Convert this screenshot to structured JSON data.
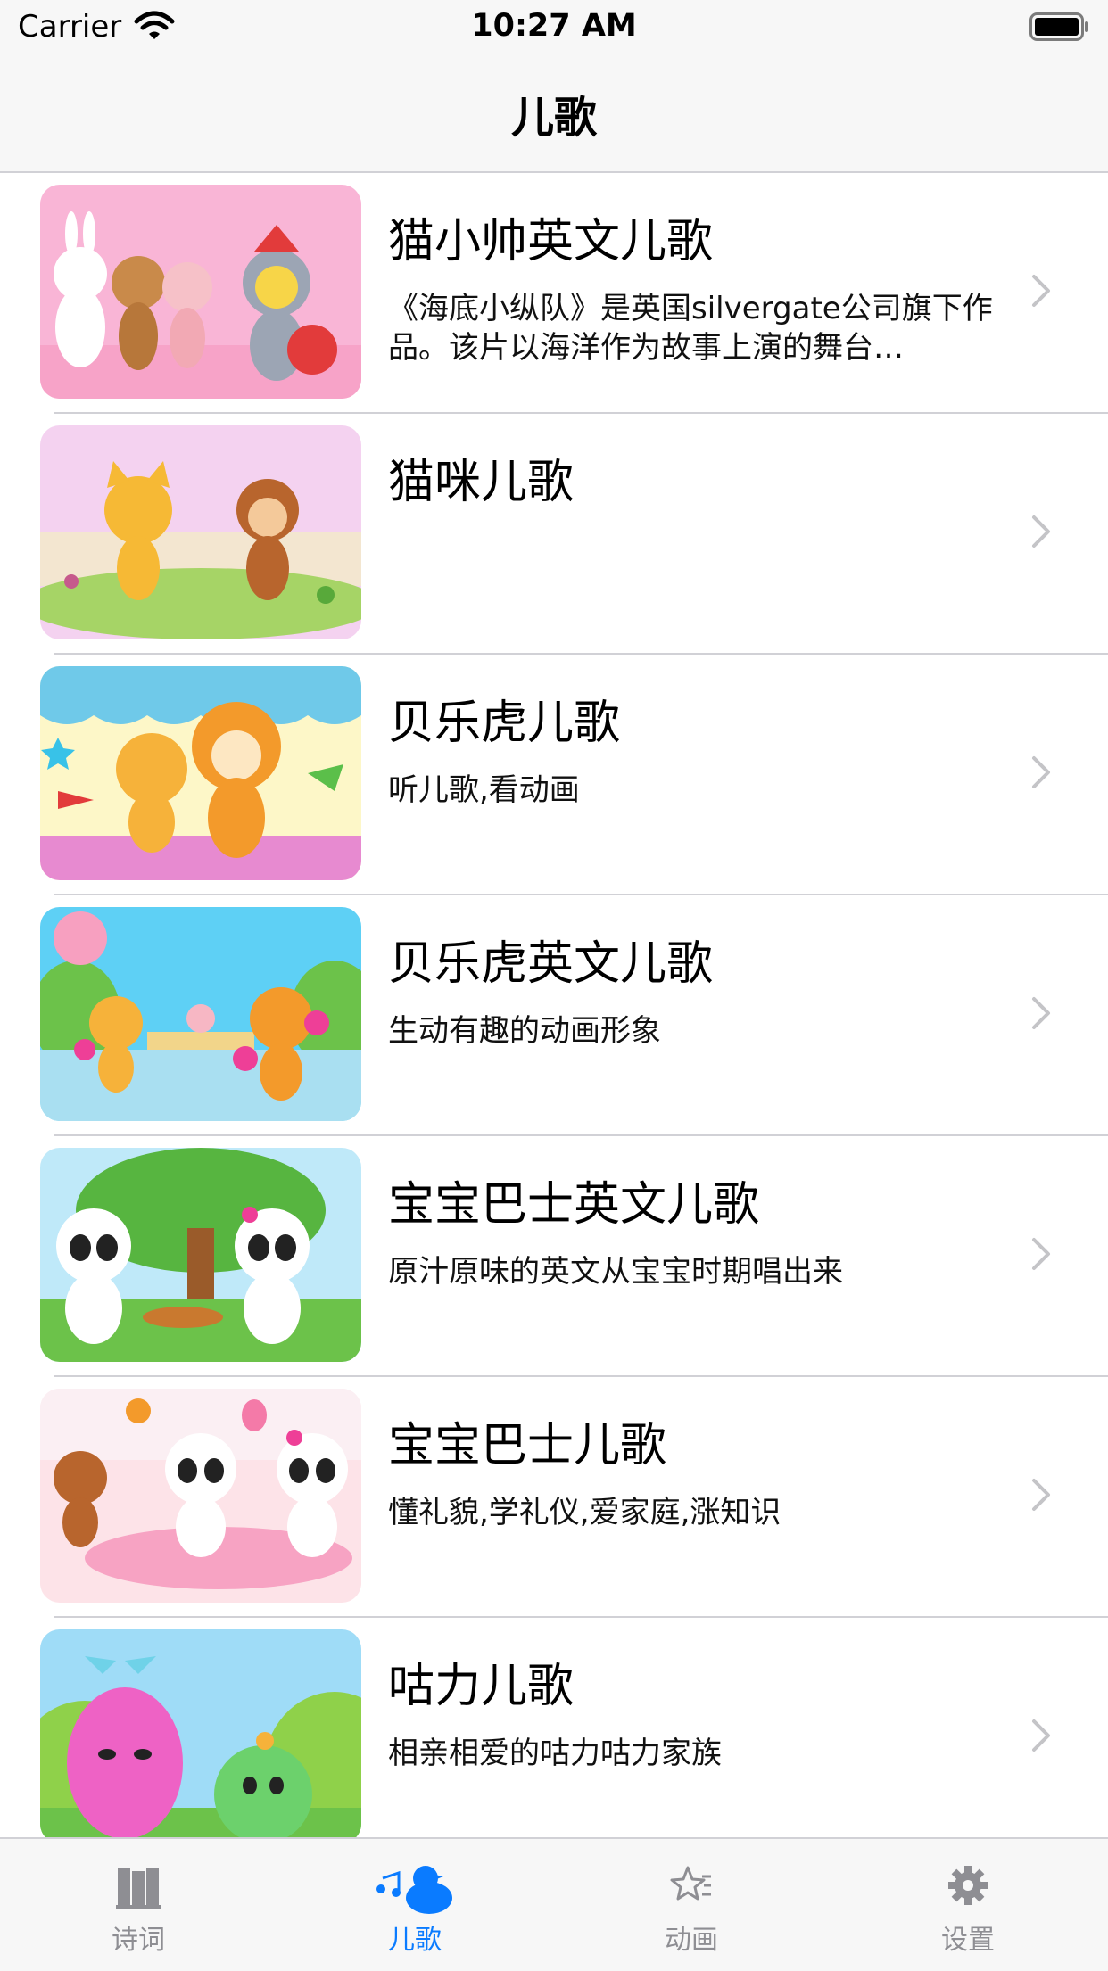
{
  "status_bar": {
    "carrier": "Carrier",
    "time": "10:27 AM"
  },
  "nav": {
    "title": "儿歌"
  },
  "items": [
    {
      "title": "猫小帅英文儿歌",
      "subtitle": "《海底小纵队》是英国silvergate公司旗下作品。该片以海洋作为故事上演的舞台…"
    },
    {
      "title": "猫咪儿歌",
      "subtitle": ""
    },
    {
      "title": "贝乐虎儿歌",
      "subtitle": "听儿歌,看动画"
    },
    {
      "title": "贝乐虎英文儿歌",
      "subtitle": "生动有趣的动画形象"
    },
    {
      "title": "宝宝巴士英文儿歌",
      "subtitle": "原汁原味的英文从宝宝时期唱出来"
    },
    {
      "title": "宝宝巴士儿歌",
      "subtitle": "懂礼貌,学礼仪,爱家庭,涨知识"
    },
    {
      "title": "咕力儿歌",
      "subtitle": "相亲相爱的咕力咕力家族"
    }
  ],
  "tabs": [
    {
      "label": "诗词",
      "icon": "book-icon"
    },
    {
      "label": "儿歌",
      "icon": "music-duck-icon",
      "selected": true
    },
    {
      "label": "动画",
      "icon": "star-icon"
    },
    {
      "label": "设置",
      "icon": "gear-icon"
    }
  ],
  "colors": {
    "accent": "#0a7bff",
    "inactive": "#8e8e93",
    "bar_bg": "#f7f7f7",
    "separator": "#d1d1d6"
  }
}
